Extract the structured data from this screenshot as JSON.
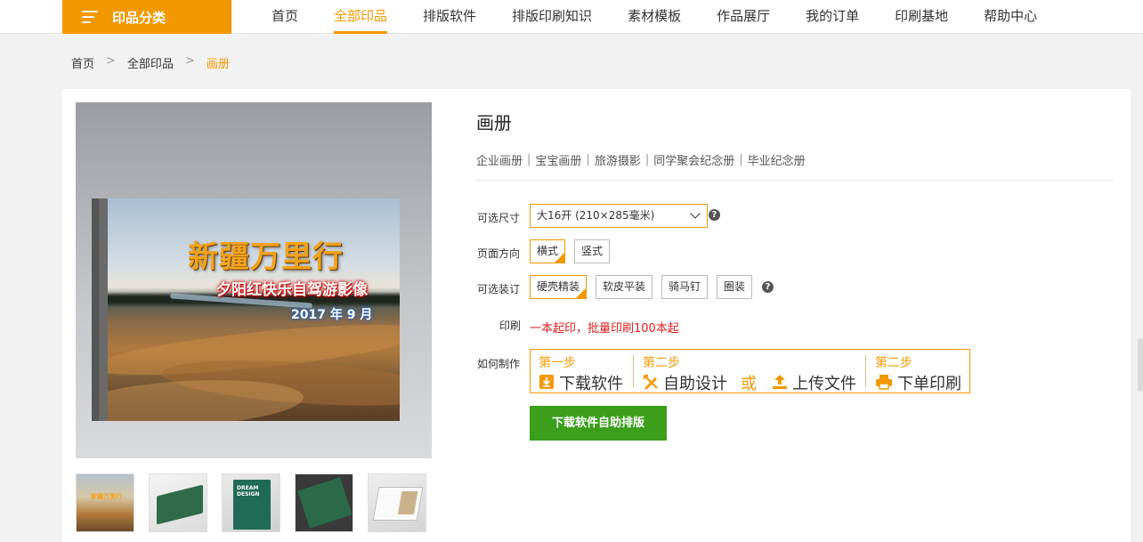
{
  "nav": {
    "category_label": "印品分类",
    "items": [
      "首页",
      "全部印品",
      "排版软件",
      "排版印刷知识",
      "素材模板",
      "作品展厅",
      "我的订单",
      "印刷基地",
      "帮助中心"
    ],
    "active": "全部印品"
  },
  "breadcrumb": {
    "home": "首页",
    "all": "全部印品",
    "current": "画册",
    "sep": ">"
  },
  "gallery": {
    "cover_title": "新疆万里行",
    "cover_subtitle": "夕阳红快乐自驾游影像",
    "cover_date": "2017 年 9 月",
    "thumb_a_text": "新疆万里行",
    "thumb_c_text": "DREAM DESIGN"
  },
  "product": {
    "title": "画册",
    "subcategories": [
      "企业画册",
      "宝宝画册",
      "旅游摄影",
      "同学聚会纪念册",
      "毕业纪念册"
    ],
    "size_label": "可选尺寸",
    "size_value": "大16开 (210×285毫米)",
    "orientation_label": "页面方向",
    "orientation_options": [
      "横式",
      "竖式"
    ],
    "orientation_selected": "横式",
    "binding_label": "可选装订",
    "binding_options": [
      "硬壳精装",
      "软皮平装",
      "骑马钉",
      "圈装"
    ],
    "binding_selected": "硬壳精装",
    "print_label": "印刷",
    "print_info": "一本起印，批量印刷100本起",
    "howto_label": "如何制作",
    "steps": {
      "step1_title": "第一步",
      "step1_label": "下载软件",
      "step2_title": "第二步",
      "step2_a": "自助设计",
      "or": "或",
      "step2_b": "上传文件",
      "step3_title": "第二步",
      "step3_label": "下单印刷"
    },
    "cta_label": "下载软件自助排版",
    "help_glyph": "?"
  },
  "colors": {
    "accent": "#f39800",
    "cta": "#3b9f1c",
    "alert": "#e01d1d"
  }
}
